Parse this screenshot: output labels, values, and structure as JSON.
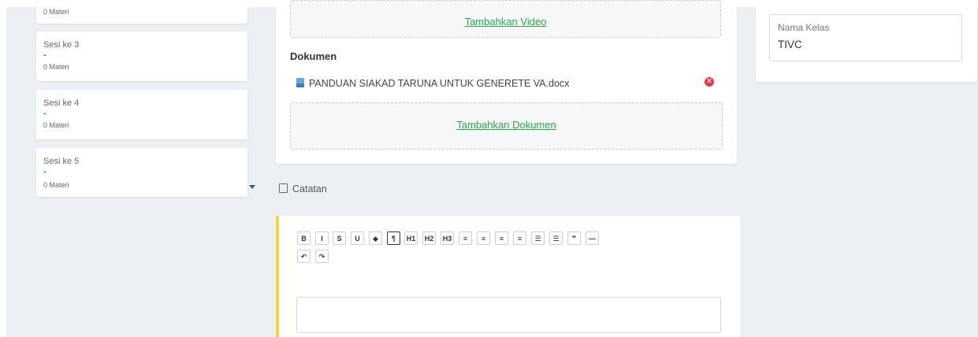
{
  "sessions": [
    {
      "title": "",
      "dash": "",
      "count": "0 Materi"
    },
    {
      "title": "Sesi ke 3",
      "dash": "-",
      "count": "0 Materi"
    },
    {
      "title": "Sesi ke 4",
      "dash": "-",
      "count": "0 Materi"
    },
    {
      "title": "Sesi ke 5",
      "dash": "-",
      "count": "0 Materi"
    }
  ],
  "media": {
    "add_video_label": "Tambahkan Video",
    "documents_heading": "Dokumen",
    "document_file_name": "PANDUAN SIAKAD TARUNA UNTUK GENERETE VA.docx",
    "add_document_label": "Tambahkan Dokumen"
  },
  "notes": {
    "label": "Catatan"
  },
  "editor": {
    "toolbar": [
      {
        "name": "bold-button",
        "label": "B"
      },
      {
        "name": "italic-button",
        "label": "I"
      },
      {
        "name": "strikethrough-button",
        "label": "S"
      },
      {
        "name": "underline-button",
        "label": "U"
      },
      {
        "name": "tag-button",
        "label": "◆"
      },
      {
        "name": "paragraph-button",
        "label": "¶"
      },
      {
        "name": "heading1-button",
        "label": "H1"
      },
      {
        "name": "heading2-button",
        "label": "H2"
      },
      {
        "name": "heading3-button",
        "label": "H3"
      },
      {
        "name": "align-left-button",
        "label": "≡"
      },
      {
        "name": "align-center-button",
        "label": "≡"
      },
      {
        "name": "align-right-button",
        "label": "≡"
      },
      {
        "name": "align-justify-button",
        "label": "≡"
      },
      {
        "name": "bullet-list-button",
        "label": "☰"
      },
      {
        "name": "ordered-list-button",
        "label": "☰"
      },
      {
        "name": "blockquote-button",
        "label": "❞"
      },
      {
        "name": "horizontal-rule-button",
        "label": "—"
      },
      {
        "name": "undo-button",
        "label": "↶"
      },
      {
        "name": "redo-button",
        "label": "↷"
      }
    ],
    "content": ""
  },
  "class_info": {
    "label": "Nama Kelas",
    "value": "TIVC"
  },
  "colors": {
    "link_green": "#2aa84a",
    "accent_yellow": "#f5d53a",
    "remove_red": "#e5394a",
    "background": "#eceff3"
  }
}
